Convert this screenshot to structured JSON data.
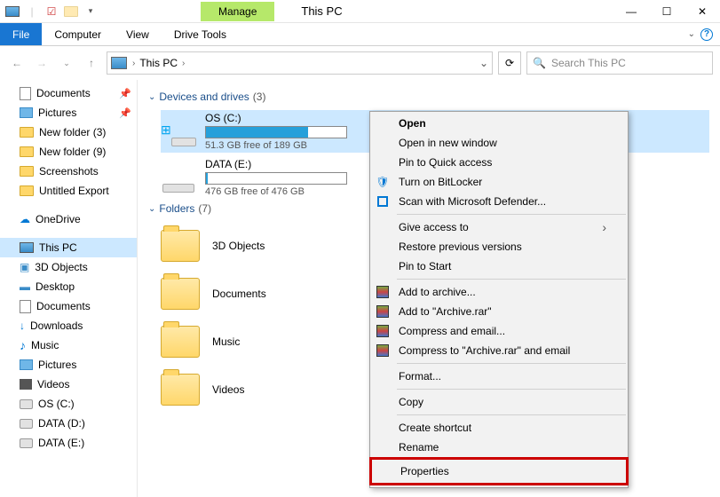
{
  "titlebar": {
    "manage_tab": "Manage",
    "title": "This PC"
  },
  "ribbon": {
    "file": "File",
    "computer": "Computer",
    "view": "View",
    "drive_tools": "Drive Tools"
  },
  "nav": {
    "crumb": "This PC",
    "search_placeholder": "Search This PC"
  },
  "sidebar": [
    {
      "icon": "doc",
      "label": "Documents",
      "pin": true
    },
    {
      "icon": "pic",
      "label": "Pictures",
      "pin": true
    },
    {
      "icon": "folder",
      "label": "New folder (3)"
    },
    {
      "icon": "folder",
      "label": "New folder (9)"
    },
    {
      "icon": "folder",
      "label": "Screenshots"
    },
    {
      "icon": "folder",
      "label": "Untitled Export"
    },
    {
      "spacer": true
    },
    {
      "icon": "onedrive",
      "label": "OneDrive"
    },
    {
      "spacer": true
    },
    {
      "icon": "pc",
      "label": "This PC",
      "sel": true
    },
    {
      "icon": "3d",
      "label": "3D Objects"
    },
    {
      "icon": "desktop",
      "label": "Desktop"
    },
    {
      "icon": "doc",
      "label": "Documents"
    },
    {
      "icon": "dl",
      "label": "Downloads"
    },
    {
      "icon": "music",
      "label": "Music"
    },
    {
      "icon": "pic",
      "label": "Pictures"
    },
    {
      "icon": "video",
      "label": "Videos"
    },
    {
      "icon": "disk",
      "label": "OS (C:)"
    },
    {
      "icon": "disk",
      "label": "DATA (D:)"
    },
    {
      "icon": "disk",
      "label": "DATA (E:)"
    }
  ],
  "groups": {
    "drives": {
      "label": "Devices and drives",
      "count": "(3)"
    },
    "folders": {
      "label": "Folders",
      "count": "(7)"
    }
  },
  "drives": [
    {
      "name": "OS (C:)",
      "free": "51.3 GB free of 189 GB",
      "fill": 73,
      "sel": true,
      "win": true
    },
    {
      "name": "DATA (E:)",
      "free": "476 GB free of 476 GB",
      "fill": 1
    }
  ],
  "folders": [
    {
      "label": "3D Objects"
    },
    {
      "label": "Documents"
    },
    {
      "label": "Music"
    },
    {
      "label": "Videos"
    }
  ],
  "ctx": {
    "open": "Open",
    "open_new": "Open in new window",
    "pin_qa": "Pin to Quick access",
    "bitlocker": "Turn on BitLocker",
    "defender": "Scan with Microsoft Defender...",
    "give_access": "Give access to",
    "restore": "Restore previous versions",
    "pin_start": "Pin to Start",
    "add_archive": "Add to archive...",
    "add_rar": "Add to \"Archive.rar\"",
    "compress_email": "Compress and email...",
    "compress_rar_email": "Compress to \"Archive.rar\" and email",
    "format": "Format...",
    "copy": "Copy",
    "shortcut": "Create shortcut",
    "rename": "Rename",
    "properties": "Properties"
  }
}
